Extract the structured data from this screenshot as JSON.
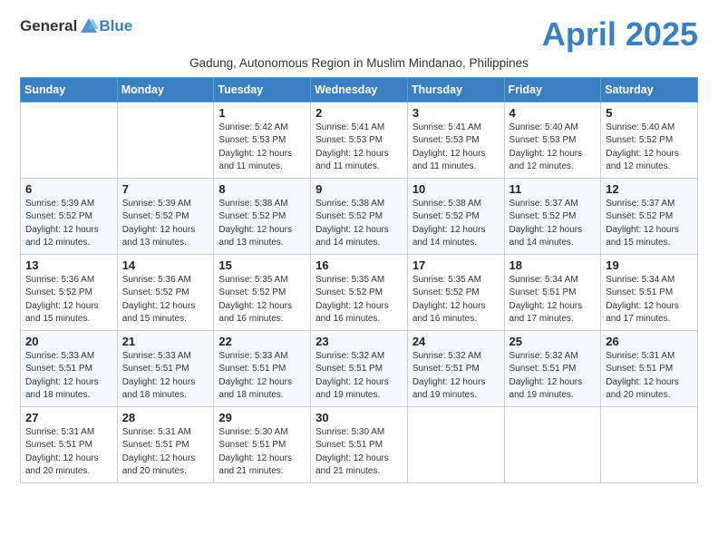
{
  "header": {
    "logo_general": "General",
    "logo_blue": "Blue",
    "month_title": "April 2025",
    "subtitle": "Gadung, Autonomous Region in Muslim Mindanao, Philippines"
  },
  "days_of_week": [
    "Sunday",
    "Monday",
    "Tuesday",
    "Wednesday",
    "Thursday",
    "Friday",
    "Saturday"
  ],
  "weeks": [
    [
      {
        "day": "",
        "info": ""
      },
      {
        "day": "",
        "info": ""
      },
      {
        "day": "1",
        "info": "Sunrise: 5:42 AM\nSunset: 5:53 PM\nDaylight: 12 hours\nand 11 minutes."
      },
      {
        "day": "2",
        "info": "Sunrise: 5:41 AM\nSunset: 5:53 PM\nDaylight: 12 hours\nand 11 minutes."
      },
      {
        "day": "3",
        "info": "Sunrise: 5:41 AM\nSunset: 5:53 PM\nDaylight: 12 hours\nand 11 minutes."
      },
      {
        "day": "4",
        "info": "Sunrise: 5:40 AM\nSunset: 5:53 PM\nDaylight: 12 hours\nand 12 minutes."
      },
      {
        "day": "5",
        "info": "Sunrise: 5:40 AM\nSunset: 5:52 PM\nDaylight: 12 hours\nand 12 minutes."
      }
    ],
    [
      {
        "day": "6",
        "info": "Sunrise: 5:39 AM\nSunset: 5:52 PM\nDaylight: 12 hours\nand 12 minutes."
      },
      {
        "day": "7",
        "info": "Sunrise: 5:39 AM\nSunset: 5:52 PM\nDaylight: 12 hours\nand 13 minutes."
      },
      {
        "day": "8",
        "info": "Sunrise: 5:38 AM\nSunset: 5:52 PM\nDaylight: 12 hours\nand 13 minutes."
      },
      {
        "day": "9",
        "info": "Sunrise: 5:38 AM\nSunset: 5:52 PM\nDaylight: 12 hours\nand 14 minutes."
      },
      {
        "day": "10",
        "info": "Sunrise: 5:38 AM\nSunset: 5:52 PM\nDaylight: 12 hours\nand 14 minutes."
      },
      {
        "day": "11",
        "info": "Sunrise: 5:37 AM\nSunset: 5:52 PM\nDaylight: 12 hours\nand 14 minutes."
      },
      {
        "day": "12",
        "info": "Sunrise: 5:37 AM\nSunset: 5:52 PM\nDaylight: 12 hours\nand 15 minutes."
      }
    ],
    [
      {
        "day": "13",
        "info": "Sunrise: 5:36 AM\nSunset: 5:52 PM\nDaylight: 12 hours\nand 15 minutes."
      },
      {
        "day": "14",
        "info": "Sunrise: 5:36 AM\nSunset: 5:52 PM\nDaylight: 12 hours\nand 15 minutes."
      },
      {
        "day": "15",
        "info": "Sunrise: 5:35 AM\nSunset: 5:52 PM\nDaylight: 12 hours\nand 16 minutes."
      },
      {
        "day": "16",
        "info": "Sunrise: 5:35 AM\nSunset: 5:52 PM\nDaylight: 12 hours\nand 16 minutes."
      },
      {
        "day": "17",
        "info": "Sunrise: 5:35 AM\nSunset: 5:52 PM\nDaylight: 12 hours\nand 16 minutes."
      },
      {
        "day": "18",
        "info": "Sunrise: 5:34 AM\nSunset: 5:51 PM\nDaylight: 12 hours\nand 17 minutes."
      },
      {
        "day": "19",
        "info": "Sunrise: 5:34 AM\nSunset: 5:51 PM\nDaylight: 12 hours\nand 17 minutes."
      }
    ],
    [
      {
        "day": "20",
        "info": "Sunrise: 5:33 AM\nSunset: 5:51 PM\nDaylight: 12 hours\nand 18 minutes."
      },
      {
        "day": "21",
        "info": "Sunrise: 5:33 AM\nSunset: 5:51 PM\nDaylight: 12 hours\nand 18 minutes."
      },
      {
        "day": "22",
        "info": "Sunrise: 5:33 AM\nSunset: 5:51 PM\nDaylight: 12 hours\nand 18 minutes."
      },
      {
        "day": "23",
        "info": "Sunrise: 5:32 AM\nSunset: 5:51 PM\nDaylight: 12 hours\nand 19 minutes."
      },
      {
        "day": "24",
        "info": "Sunrise: 5:32 AM\nSunset: 5:51 PM\nDaylight: 12 hours\nand 19 minutes."
      },
      {
        "day": "25",
        "info": "Sunrise: 5:32 AM\nSunset: 5:51 PM\nDaylight: 12 hours\nand 19 minutes."
      },
      {
        "day": "26",
        "info": "Sunrise: 5:31 AM\nSunset: 5:51 PM\nDaylight: 12 hours\nand 20 minutes."
      }
    ],
    [
      {
        "day": "27",
        "info": "Sunrise: 5:31 AM\nSunset: 5:51 PM\nDaylight: 12 hours\nand 20 minutes."
      },
      {
        "day": "28",
        "info": "Sunrise: 5:31 AM\nSunset: 5:51 PM\nDaylight: 12 hours\nand 20 minutes."
      },
      {
        "day": "29",
        "info": "Sunrise: 5:30 AM\nSunset: 5:51 PM\nDaylight: 12 hours\nand 21 minutes."
      },
      {
        "day": "30",
        "info": "Sunrise: 5:30 AM\nSunset: 5:51 PM\nDaylight: 12 hours\nand 21 minutes."
      },
      {
        "day": "",
        "info": ""
      },
      {
        "day": "",
        "info": ""
      },
      {
        "day": "",
        "info": ""
      }
    ]
  ]
}
